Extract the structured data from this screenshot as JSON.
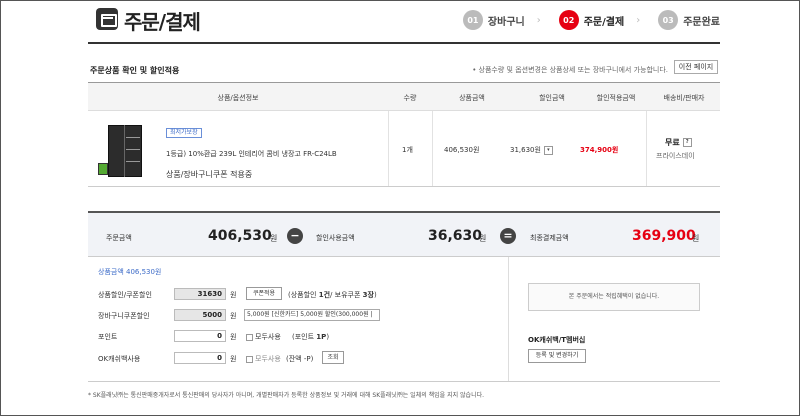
{
  "header": {
    "title": "주문/결제",
    "steps": [
      {
        "num": "01",
        "label": "장바구니",
        "active": false
      },
      {
        "num": "02",
        "label": "주문/결제",
        "active": true
      },
      {
        "num": "03",
        "label": "주문완료",
        "active": false
      }
    ]
  },
  "section": {
    "title": "주문상품 확인 및 할인적용",
    "note": "• 상품수량 및 옵션변경은 상품상세 또는 장바구니에서 가능합니다.",
    "prev_button": "이전 페이지"
  },
  "table": {
    "headers": [
      "상품/옵션정보",
      "수량",
      "상품금액",
      "할인금액",
      "할인적용금액",
      "배송비/판매자"
    ],
    "row": {
      "badge": "최저가보장",
      "name": "1등급) 10%환급 239L 인테리어 콤비 냉장고 FR-C24LB",
      "coupon": "상품/장바구니쿠폰 적용중",
      "qty": "1개",
      "price": "406,530원",
      "discount": "31,630원",
      "discount_btn": "▾",
      "final": "374,900원",
      "shipping": "무료",
      "shipping_btn": "?",
      "seller": "프라이스데이"
    }
  },
  "summary": {
    "order_label": "주문금액",
    "order_value": "406,530",
    "discount_label": "할인사용금액",
    "discount_value": "36,630",
    "final_label": "최종결제금액",
    "final_value": "369,900",
    "unit": "원",
    "minus": "−",
    "equals": "="
  },
  "discount_form": {
    "order_amount": "상품금액 406,530원",
    "coupon_label": "상품할인/쿠폰할인",
    "coupon_value": "31630",
    "coupon_btn": "쿠폰적용",
    "coupon_info_prefix": "(상품할인",
    "coupon_info_count": "1건",
    "coupon_info_mid": "/ 보유쿠폰",
    "coupon_info_owned": "3장",
    "coupon_info_suffix": ")",
    "cart_coupon_label": "장바구니쿠폰할인",
    "cart_coupon_value": "5000",
    "cart_coupon_select": "5,000원 [신한카드] 5,000원 할인(300,000원 |",
    "point_label": "포인트",
    "point_value": "0",
    "point_all": "모두사용",
    "point_info_prefix": "(포인트",
    "point_info_value": "1P",
    "point_info_suffix": ")",
    "ok_label": "OK캐쉬백사용",
    "ok_value": "0",
    "ok_all": "모두사용",
    "ok_info": "(잔액 -P)",
    "ok_lookup": "조회",
    "unit": "원"
  },
  "right_panel": {
    "benefit_text": "본 주문에서는 적립혜택이 없습니다.",
    "ok_title": "OK캐쉬백/T멤버십",
    "ok_button": "등록 및 변경하기"
  },
  "footnote": "* SK플래닛㈜는 통신판매중개자로서 통신판매의 당사자가 아니며, 개별판매자가 등록한 상품정보 및 거래에 대해 SK플래닛㈜는 일체의 책임을 지지 않습니다."
}
